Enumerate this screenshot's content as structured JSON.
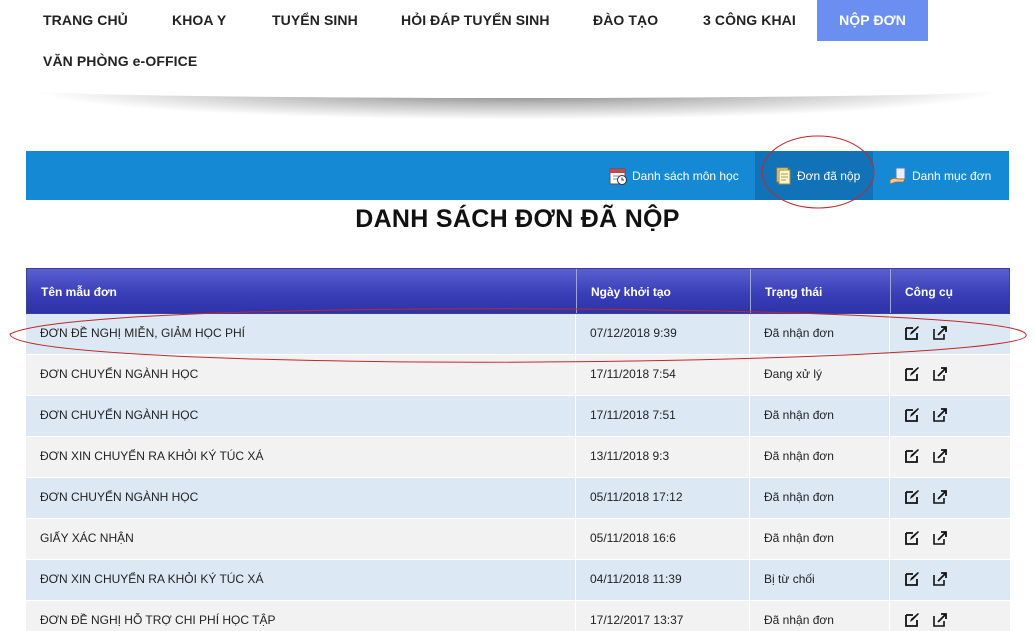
{
  "nav": {
    "items": [
      "TRANG CHỦ",
      "KHOA Y",
      "TUYỂN SINH",
      "HỎI ĐÁP TUYỂN SINH",
      "ĐÀO TẠO",
      "3 CÔNG KHAI",
      "NỘP ĐƠN"
    ],
    "second_row": "VĂN PHÒNG e-OFFICE",
    "active_index": 6
  },
  "toolbar": {
    "subjects": "Danh sách môn học",
    "submitted": "Đơn đã nộp",
    "catalog": "Danh mục đơn"
  },
  "page": {
    "title": "DANH SÁCH ĐƠN ĐÃ NỘP"
  },
  "table": {
    "headers": {
      "name": "Tên mẫu đơn",
      "date": "Ngày khởi tạo",
      "status": "Trạng thái",
      "tools": "Công cụ"
    },
    "rows": [
      {
        "name": "ĐƠN ĐỀ NGHỊ MIỄN, GIẢM HỌC PHÍ",
        "date": "07/12/2018 9:39",
        "status": "Đã nhận đơn"
      },
      {
        "name": "ĐƠN CHUYỂN NGÀNH HỌC",
        "date": "17/11/2018 7:54",
        "status": "Đang xử lý"
      },
      {
        "name": "ĐƠN CHUYỂN NGÀNH HỌC",
        "date": "17/11/2018 7:51",
        "status": "Đã nhận đơn"
      },
      {
        "name": "ĐƠN XIN CHUYỂN RA KHỎI KÝ TÚC XÁ",
        "date": "13/11/2018 9:3",
        "status": "Đã nhận đơn"
      },
      {
        "name": "ĐƠN CHUYỂN NGÀNH HỌC",
        "date": "05/11/2018 17:12",
        "status": "Đã nhận đơn"
      },
      {
        "name": "GIẤY XÁC NHẬN",
        "date": "05/11/2018 16:6",
        "status": "Đã nhận đơn"
      },
      {
        "name": "ĐƠN XIN CHUYỂN RA KHỎI KÝ TÚC XÁ",
        "date": "04/11/2018 11:39",
        "status": "Bị từ chối"
      },
      {
        "name": "ĐƠN ĐỀ NGHỊ HỖ TRỢ CHI PHÍ HỌC TẬP",
        "date": "17/12/2017 13:37",
        "status": "Đã nhận đơn"
      }
    ],
    "tool_icons": [
      "edit-icon",
      "open-external-icon"
    ]
  },
  "colors": {
    "toolbar": "#1689d5",
    "nav_active": "#6b8ff0",
    "header": "#3a3fb8",
    "row_alt": "#dce9f5",
    "annotation": "#c0282a"
  }
}
